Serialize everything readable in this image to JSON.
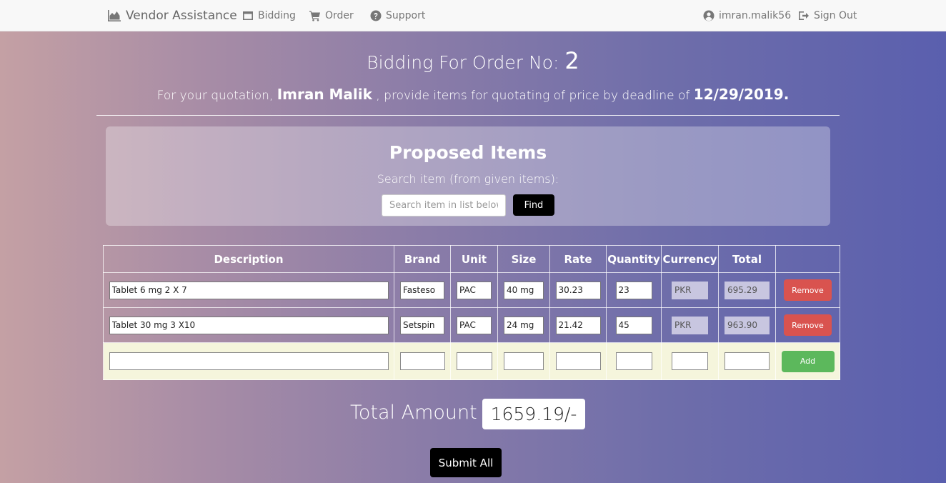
{
  "nav": {
    "brand": "Vendor Assistance",
    "links": {
      "bidding": "Bidding",
      "order": "Order",
      "support": "Support"
    },
    "user": "imran.malik56",
    "signout": "Sign Out"
  },
  "header": {
    "title_prefix": "Bidding For Order No:",
    "order_no": "2",
    "sub_prefix": "For your quotation,",
    "vendor_name": "Imran Malik",
    "sub_middle": ", provide items for quotating of price by deadline of",
    "deadline": "12/29/2019."
  },
  "panel": {
    "title": "Proposed Items",
    "search_label": "Search item (from given items):",
    "search_placeholder": "Search item in list below",
    "find_label": "Find"
  },
  "table": {
    "headers": [
      "Description",
      "Brand",
      "Unit",
      "Size",
      "Rate",
      "Quantity",
      "Currency",
      "Total"
    ],
    "rows": [
      {
        "description": "Tablet 6 mg 2 X 7",
        "brand": "Fasteso",
        "unit": "PAC",
        "size": "40 mg",
        "rate": "30.23",
        "quantity": "23",
        "currency": "PKR",
        "total": "695.29",
        "action": "Remove"
      },
      {
        "description": "Tablet 30 mg 3 X10",
        "brand": "Setspin",
        "unit": "PAC",
        "size": "24 mg",
        "rate": "21.42",
        "quantity": "45",
        "currency": "PKR",
        "total": "963.90",
        "action": "Remove"
      }
    ],
    "add_label": "Add"
  },
  "summary": {
    "total_label": "Total Amount :",
    "total_value": "1659.19/-",
    "submit_label": "Submit All"
  },
  "colors": {
    "remove": "#d9534f",
    "add": "#5cb85c",
    "new_row_bg": "#f5f5dc"
  }
}
